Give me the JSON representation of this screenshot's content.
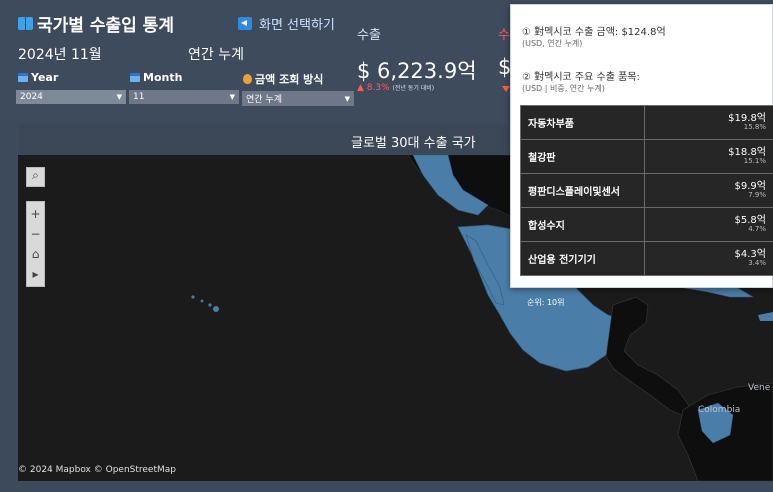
{
  "header": {
    "title": "국가별 수출입 통계",
    "screen_select": "화면 선택하기",
    "period": "2024년 11월",
    "cumulative": "연간 누계"
  },
  "filters": {
    "year": {
      "label": "Year",
      "value": "2024"
    },
    "month": {
      "label": "Month",
      "value": "11"
    },
    "method": {
      "label": "금액 조회 방식",
      "value": "연간 누계"
    }
  },
  "kpi": {
    "export_label": "수출",
    "export_value": "$ 6,223.9억",
    "export_change": "▲ 8.3%",
    "export_change_note": "(전년 동기 대비)",
    "import_label": "수",
    "import_value": "$"
  },
  "map": {
    "title": "글로벌 30대 수출 국가",
    "rank_label": "순위: 10위",
    "credit": "© 2024 Mapbox © OpenStreetMap",
    "countries": [
      "Vene",
      "Colombia"
    ]
  },
  "tooltip": {
    "line1": "① 對멕시코 수출 금액: $124.8억",
    "sub1": "(USD, 연간 누계)",
    "line2": "② 對멕시코 주요 수출 품목:",
    "sub2": "(USD | 비중, 연간 누계)",
    "rows": [
      {
        "name": "자동차부품",
        "amount": "$19.8억",
        "share": "15.8%"
      },
      {
        "name": "철강판",
        "amount": "$18.8억",
        "share": "15.1%"
      },
      {
        "name": "평판디스플레이및센서",
        "amount": "$9.9억",
        "share": "7.9%"
      },
      {
        "name": "합성수지",
        "amount": "$5.8억",
        "share": "4.7%"
      },
      {
        "name": "산업용 전기기기",
        "amount": "$4.3억",
        "share": "3.4%"
      }
    ]
  },
  "colors": {
    "highlight_country": "#4a7ea8",
    "map_bg": "#1b1b1b",
    "header_bg": "#3d4b5d",
    "negative": "#ff5a5a"
  }
}
